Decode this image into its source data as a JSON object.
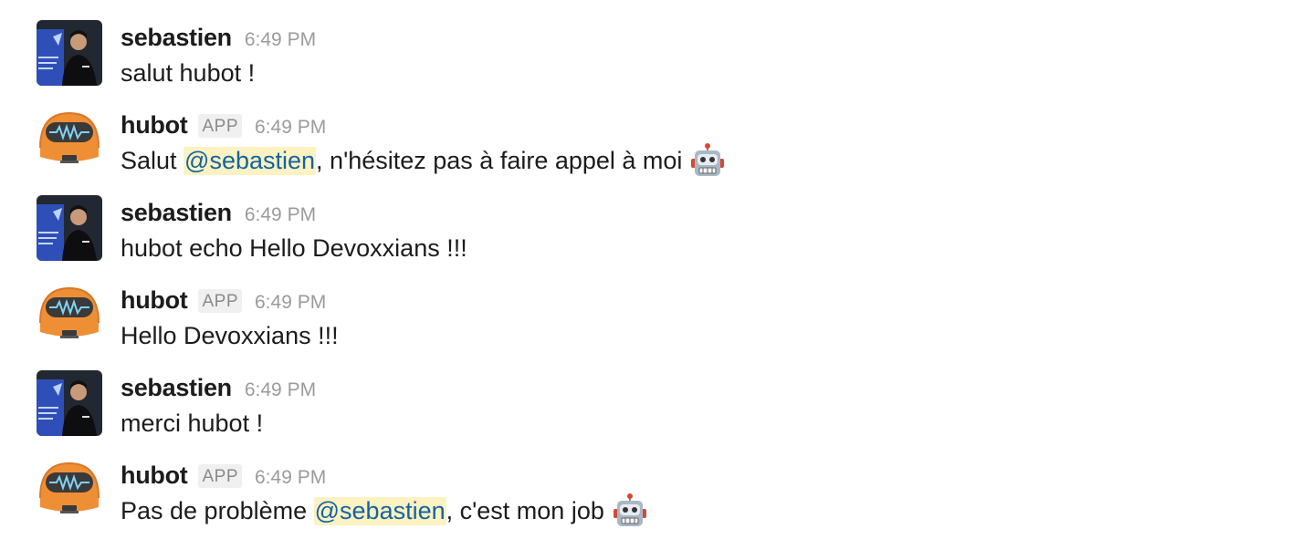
{
  "messages": [
    {
      "author": "sebastien",
      "is_app": false,
      "time": "6:49 PM",
      "text_before": "salut hubot !",
      "mention": "",
      "text_after": "",
      "emoji": ""
    },
    {
      "author": "hubot",
      "is_app": true,
      "app_label": "APP",
      "time": "6:49 PM",
      "text_before": "Salut ",
      "mention": "@sebastien",
      "text_after": ", n'hésitez pas à faire appel à moi",
      "emoji": "robot-face"
    },
    {
      "author": "sebastien",
      "is_app": false,
      "time": "6:49 PM",
      "text_before": "hubot echo Hello Devoxxians !!!",
      "mention": "",
      "text_after": "",
      "emoji": ""
    },
    {
      "author": "hubot",
      "is_app": true,
      "app_label": "APP",
      "time": "6:49 PM",
      "text_before": "Hello Devoxxians !!!",
      "mention": "",
      "text_after": "",
      "emoji": ""
    },
    {
      "author": "sebastien",
      "is_app": false,
      "time": "6:49 PM",
      "text_before": "merci hubot !",
      "mention": "",
      "text_after": "",
      "emoji": ""
    },
    {
      "author": "hubot",
      "is_app": true,
      "app_label": "APP",
      "time": "6:49 PM",
      "text_before": "Pas de problème ",
      "mention": "@sebastien",
      "text_after": ", c'est mon job",
      "emoji": "robot-face"
    }
  ],
  "colors": {
    "author": "#1d1c1d",
    "timestamp": "#9b9b9b",
    "mention_text": "#1264a3",
    "mention_bg": "#fdf2c1",
    "hubot_orange": "#ef8f35"
  },
  "icons": {
    "user_avatar": "user-photo-avatar",
    "bot_avatar": "hubot-avatar",
    "emoji": "robot-face-icon"
  }
}
